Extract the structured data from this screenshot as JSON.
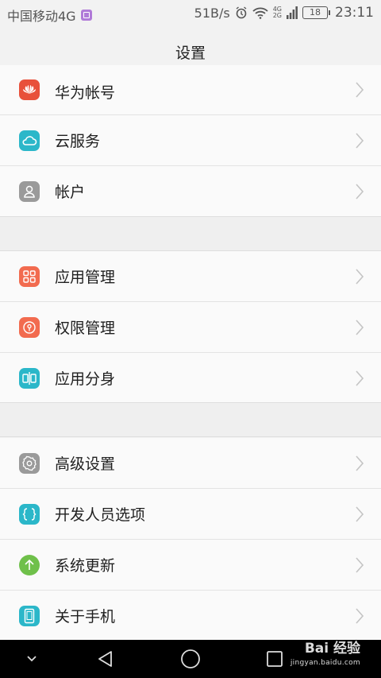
{
  "status_bar": {
    "carrier": "中国移动4G",
    "net_speed": "51B/s",
    "net_type_top": "4G",
    "net_type_bottom": "2G",
    "battery": "18",
    "time": "23:11"
  },
  "header": {
    "title": "设置"
  },
  "groups": [
    {
      "items": [
        {
          "label": "华为帐号",
          "icon": "huawei-logo-icon",
          "color": "#e8503a"
        },
        {
          "label": "云服务",
          "icon": "cloud-icon",
          "color": "#2bb7c9"
        },
        {
          "label": "帐户",
          "icon": "person-icon",
          "color": "#9a9a9a"
        }
      ]
    },
    {
      "items": [
        {
          "label": "应用管理",
          "icon": "grid-icon",
          "color": "#f26b4f"
        },
        {
          "label": "权限管理",
          "icon": "key-icon",
          "color": "#f26b4f"
        },
        {
          "label": "应用分身",
          "icon": "app-twin-icon",
          "color": "#2bb7c9"
        }
      ]
    },
    {
      "items": [
        {
          "label": "高级设置",
          "icon": "gear-icon",
          "color": "#9a9a9a"
        },
        {
          "label": "开发人员选项",
          "icon": "braces-icon",
          "color": "#2bb7c9"
        },
        {
          "label": "系统更新",
          "icon": "arrow-up-icon",
          "color": "#6fc04a"
        },
        {
          "label": "关于手机",
          "icon": "phone-icon",
          "color": "#2bb7c9"
        }
      ]
    }
  ],
  "watermark": {
    "brand": "Bai 经验",
    "url": "jingyan.baidu.com"
  }
}
